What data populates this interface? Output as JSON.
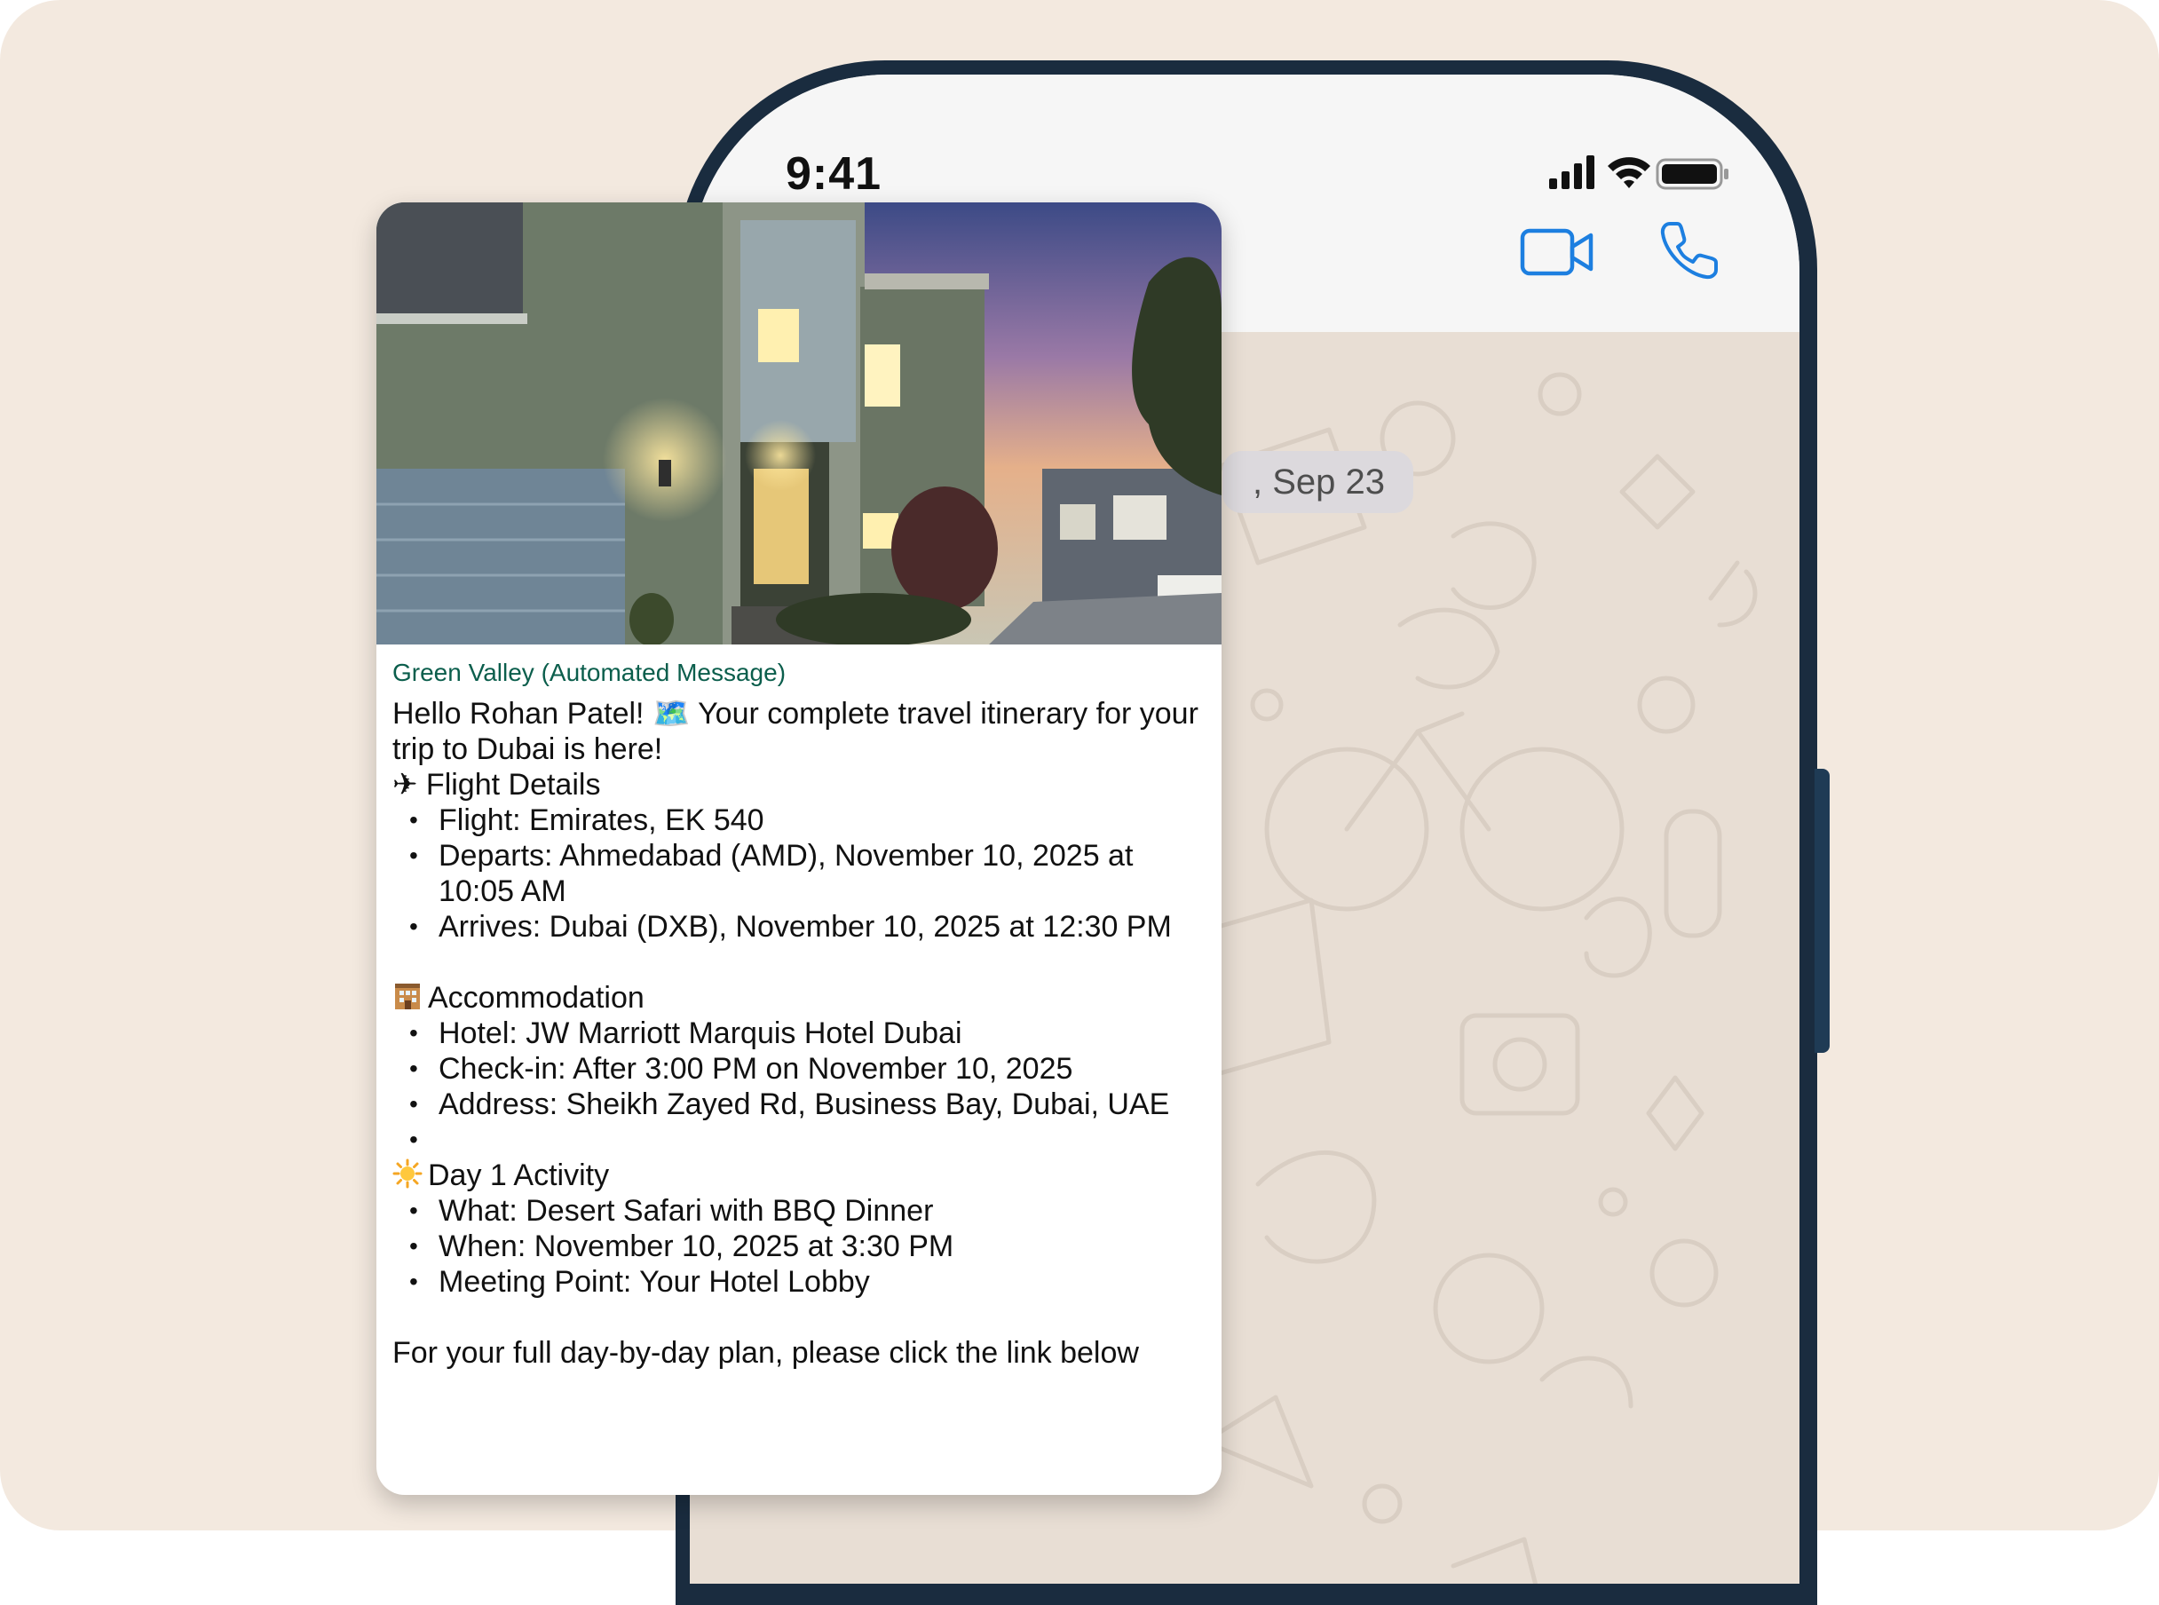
{
  "status_bar": {
    "time": "9:41"
  },
  "chat": {
    "date_chip": ", Sep 23"
  },
  "message": {
    "sender": "Green Valley (Automated Message)",
    "intro": "Hello Rohan Patel! 🗺️ Your complete travel itinerary for your trip to Dubai is here!",
    "flight": {
      "heading": "✈ Flight Details",
      "items": [
        "Flight: Emirates, EK 540",
        "Departs: Ahmedabad (AMD), November 10, 2025 at 10:05 AM",
        "Arrives: Dubai (DXB), November 10, 2025 at 12:30 PM"
      ]
    },
    "accommodation": {
      "heading": "Accommodation",
      "items": [
        "Hotel: JW Marriott Marquis Hotel Dubai",
        "Check-in: After 3:00 PM on November 10, 2025",
        "Address: Sheikh Zayed Rd, Business Bay, Dubai, UAE",
        ""
      ]
    },
    "activity": {
      "heading": "Day 1 Activity",
      "items": [
        "What: Desert Safari with BBQ Dinner",
        "When: November 10, 2025 at 3:30 PM",
        "Meeting Point: Your Hotel Lobby"
      ]
    },
    "footer": "For your full day-by-day plan, please click the link below"
  },
  "icons": {
    "signal": "signal-bars-icon",
    "wifi": "wifi-icon",
    "battery": "battery-icon",
    "video": "video-call-icon",
    "call": "phone-call-icon",
    "hotel": "hotel-icon",
    "sun": "sun-icon"
  },
  "colors": {
    "backdrop": "#f3e9df",
    "phone_frame": "#1a2c3f",
    "chat_wallpaper": "#e8ded4",
    "accent_blue": "#1d7fe0",
    "sender_green": "#0b5e4c"
  }
}
